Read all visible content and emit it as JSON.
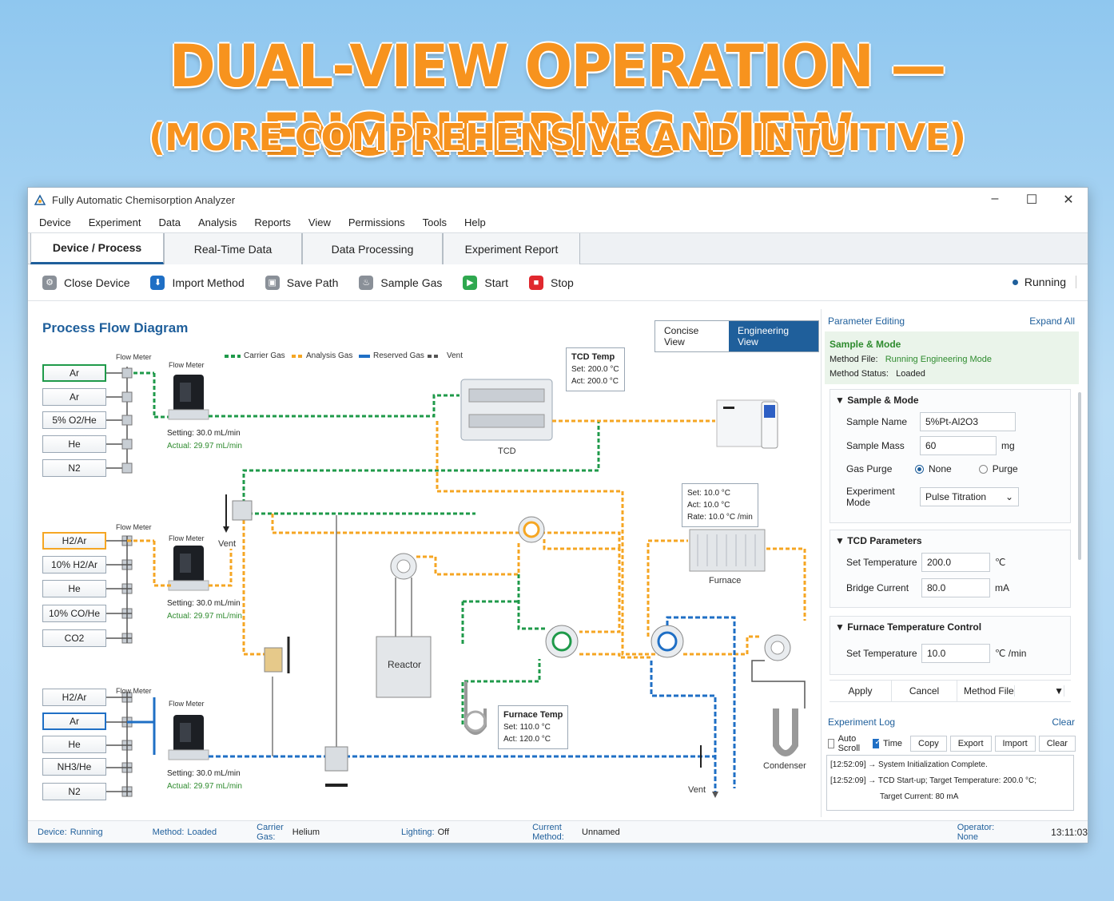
{
  "banner": {
    "title": "DUAL-VIEW OPERATION — ENGINEERING VIEW",
    "subtitle": "(MORE COMPREHENSIVE AND INTUITIVE)"
  },
  "window": {
    "title": "Fully Automatic Chemisorption Analyzer",
    "controls": [
      "–",
      "☐",
      "✕"
    ]
  },
  "menu": [
    "Device",
    "Experiment",
    "Data",
    "Analysis",
    "Reports",
    "View",
    "Permissions",
    "Tools",
    "Help"
  ],
  "tabs": [
    "Device / Process",
    "Real-Time Data",
    "Data Processing",
    "Experiment Report"
  ],
  "toolbar": {
    "close_device": "Close Device",
    "import_method": "Import Method",
    "save_path": "Save Path",
    "sample_gas": "Sample Gas",
    "start": "Start",
    "stop": "Stop",
    "status": "Running"
  },
  "diagram": {
    "title": "Process Flow Diagram",
    "views": [
      "Concise View",
      "Engineering View"
    ],
    "legend": [
      "Carrier Gas",
      "Analysis Gas",
      "Reserved Gas",
      "Vent"
    ],
    "colors": {
      "carrier": "#1f9a4a",
      "analysis": "#f5a623",
      "reserved": "#1f6fc5",
      "vent": "#555555"
    },
    "group1": [
      "Ar",
      "Ar",
      "5% O2/He",
      "He",
      "N2"
    ],
    "group2": [
      "H2/Ar",
      "10% H2/Ar",
      "He",
      "10% CO/He",
      "CO2"
    ],
    "group3": [
      "H2/Ar",
      "Ar",
      "He",
      "NH3/He",
      "N2"
    ],
    "flow_meter": "Flow Meter",
    "setting1": "Setting: 30.0 mL/min",
    "actual1": "Actual: 29.97 mL/min",
    "setting2": "Setting: 30.0 mL/min",
    "actual2": "Actual: 29.97 mL/min",
    "setting3": "Setting: 30.0 mL/min",
    "actual3": "Actual: 29.97 mL/min",
    "tcd_temp": {
      "title": "TCD Temp",
      "set": "Set: 200.0 °C",
      "act": "Act: 200.0 °C"
    },
    "furnace_box": {
      "set": "Set: 10.0 °C",
      "act": "Act: 10.0 °C",
      "rate": "Rate: 10.0 °C /min"
    },
    "furnace_temp": {
      "title": "Furnace Temp",
      "set": "Set: 110.0 °C",
      "act": "Act: 120.0 °C"
    },
    "labels": {
      "tcd": "TCD",
      "furnace": "Furnace",
      "reactor": "Reactor",
      "condenser": "Condenser",
      "vent1": "Vent",
      "vent2": "Vent"
    }
  },
  "panel": {
    "header": "Parameter Editing",
    "expand": "Expand All",
    "mode_title": "Sample & Mode",
    "method_file_k": "Method File:",
    "method_file_v": "Running Engineering Mode",
    "method_status_k": "Method Status:",
    "method_status_v": "Loaded",
    "sec1": "Sample & Mode",
    "sample_name_k": "Sample Name",
    "sample_name_v": "5%Pt-Al2O3",
    "sample_mass_k": "Sample Mass",
    "sample_mass_v": "60",
    "sample_mass_u": "mg",
    "gas_purge_k": "Gas Purge",
    "gas_purge_none": "None",
    "gas_purge_purge": "Purge",
    "exp_mode_k": "Experiment Mode",
    "exp_mode_v": "Pulse Titration",
    "sec2": "TCD Parameters",
    "set_temp_k": "Set Temperature",
    "set_temp_v": "200.0",
    "set_temp_u": "℃",
    "bridge_k": "Bridge Current",
    "bridge_v": "80.0",
    "bridge_u": "mA",
    "sec3": "Furnace Temperature Control",
    "f_temp_k": "Set Temperature",
    "f_temp_v": "10.0",
    "f_temp_u": "℃ /min",
    "apply": "Apply",
    "cancel": "Cancel",
    "method_file": "Method File",
    "log_title": "Experiment Log",
    "log_clear": "Clear",
    "auto_scroll": "Auto Scroll",
    "time": "Time",
    "log_buttons": [
      "Copy",
      "Export",
      "Import",
      "Clear"
    ],
    "log_lines": [
      "[12:52:09]  → System Initialization Complete.",
      "[12:52:09]  → TCD Start-up; Target Temperature: 200.0 °C;",
      "Target Current:  80 mA"
    ]
  },
  "status": {
    "device_k": "Device:",
    "device_v": "Running",
    "method_k": "Method:",
    "method_v": "Loaded",
    "carrier_k": "Carrier Gas:",
    "carrier_v": "Helium",
    "lighting_k": "Lighting:",
    "lighting_v": "Off",
    "current_k": "Current  Method:",
    "current_v": "Unnamed",
    "operator": "Operator: None",
    "time": "13:11:03"
  }
}
